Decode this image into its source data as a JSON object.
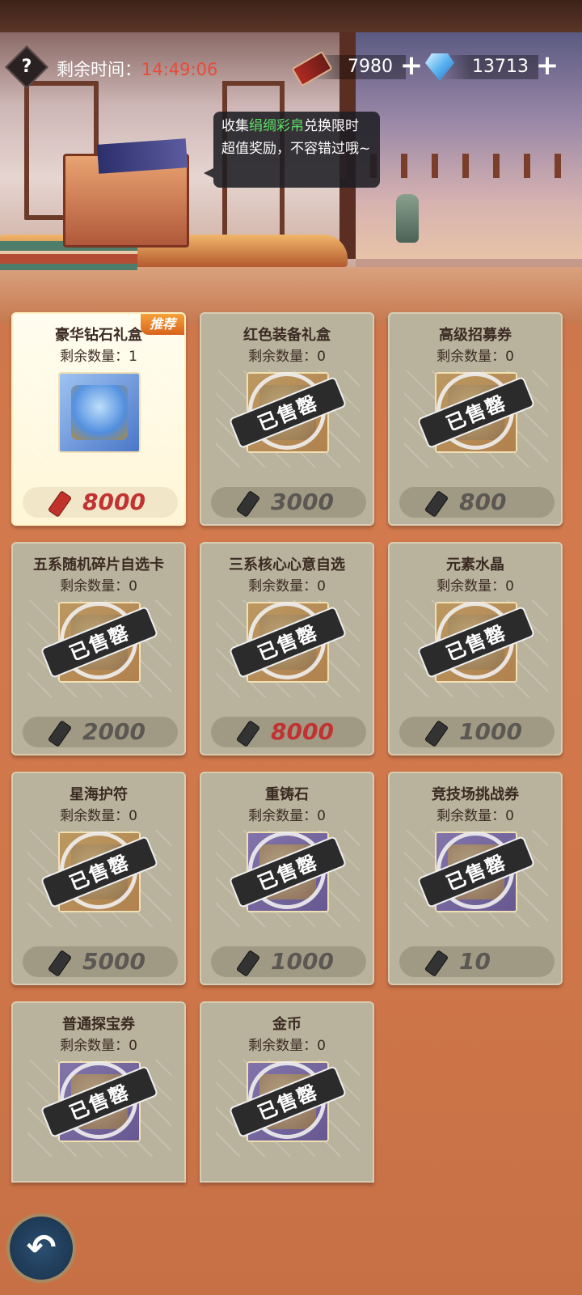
{
  "header": {
    "help_label": "?",
    "time_label": "剩余时间：",
    "time_value": "14:49:06",
    "silk_count": "7980",
    "diamond_count": "13713",
    "plus_label": "+"
  },
  "tooltip": {
    "prefix": "收集",
    "highlight": "绢绸彩帛",
    "suffix": "兑换限时超值奖励，不容错过哦~"
  },
  "soldout_label": "已售罄",
  "qty_label": "剩余数量：",
  "recommend_label": "推荐",
  "items": [
    {
      "name": "豪华钻石礼盒",
      "qty": "1",
      "price": "8000",
      "sold_out": false
    },
    {
      "name": "红色装备礼盒",
      "qty": "0",
      "price": "3000",
      "sold_out": true
    },
    {
      "name": "高级招募券",
      "qty": "0",
      "price": "800",
      "sold_out": true
    },
    {
      "name": "五系随机碎片自选卡",
      "qty": "0",
      "price": "2000",
      "sold_out": true
    },
    {
      "name": "三系核心心意自选",
      "qty": "0",
      "price": "8000",
      "sold_out": true
    },
    {
      "name": "元素水晶",
      "qty": "0",
      "price": "1000",
      "sold_out": true
    },
    {
      "name": "星海护符",
      "qty": "0",
      "price": "5000",
      "sold_out": true
    },
    {
      "name": "重铸石",
      "qty": "0",
      "price": "1000",
      "sold_out": true
    },
    {
      "name": "竞技场挑战券",
      "qty": "0",
      "price": "10",
      "sold_out": true
    },
    {
      "name": "普通探宝券",
      "qty": "0",
      "price": "",
      "sold_out": true
    },
    {
      "name": "金币",
      "qty": "0",
      "price": "",
      "sold_out": true
    }
  ],
  "back_icon": "↶"
}
